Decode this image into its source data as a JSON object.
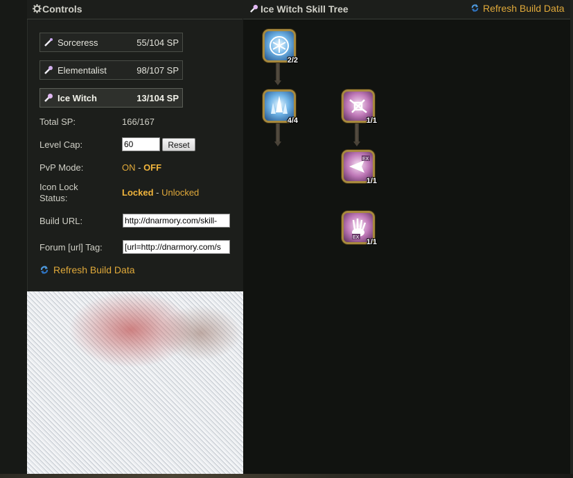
{
  "controls_panel": {
    "title": "Controls",
    "class_tabs": [
      {
        "name": "Sorceress",
        "sp": "55/104 SP"
      },
      {
        "name": "Elementalist",
        "sp": "98/107 SP"
      },
      {
        "name": "Ice Witch",
        "sp": "13/104 SP",
        "active": true
      }
    ],
    "total_sp_label": "Total SP:",
    "total_sp_value": "166/167",
    "level_cap_label": "Level Cap:",
    "level_cap_value": "60",
    "reset_label": "Reset",
    "pvp_label": "PvP Mode:",
    "pvp_on": "ON",
    "pvp_separator": " - ",
    "pvp_off": "OFF",
    "icon_lock_label_1": "Icon Lock",
    "icon_lock_label_2": "Status:",
    "icon_lock_locked": "Locked",
    "icon_lock_separator": " - ",
    "icon_lock_unlocked": "Unlocked",
    "build_url_label": "Build URL:",
    "build_url_value": "http://dnarmory.com/skill-",
    "forum_tag_label": "Forum [url] Tag:",
    "forum_tag_value": "[url=http://dnarmory.com/s",
    "refresh_label": "Refresh Build Data"
  },
  "tree_panel": {
    "title": "Ice Witch Skill Tree",
    "refresh_label": "Refresh Build Data",
    "skills": [
      {
        "icon": "snowflake-skill-icon",
        "level": "2/2",
        "style": "ice"
      },
      {
        "icon": "ice-spike-skill-icon",
        "level": "4/4",
        "style": "ice"
      },
      {
        "icon": "shatter-skill-icon",
        "level": "1/1",
        "style": "pink"
      },
      {
        "icon": "ex-arrow-skill-icon",
        "level": "1/1",
        "style": "pink"
      },
      {
        "icon": "ex-hand-skill-icon",
        "level": "1/1",
        "style": "pink"
      }
    ]
  },
  "colors": {
    "accent": "#e0a93a",
    "panel_bg": "#1c1e1b",
    "page_bg": "#111310"
  }
}
